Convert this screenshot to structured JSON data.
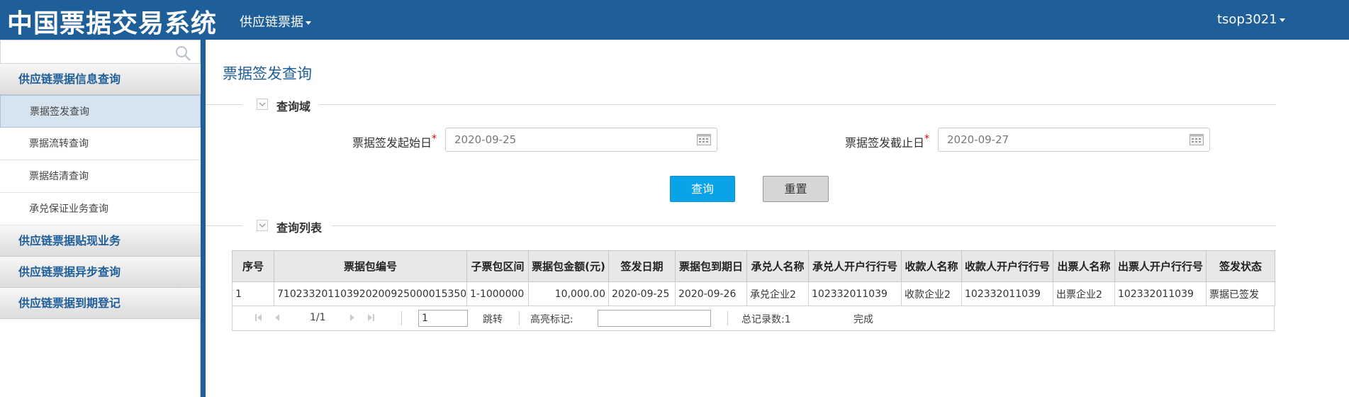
{
  "header": {
    "app_title": "中国票据交易系统",
    "nav_menu_label": "供应链票据",
    "user_label": "tsop3021"
  },
  "sidebar": {
    "search_placeholder": "",
    "groups": [
      {
        "label": "供应链票据信息查询"
      },
      {
        "label": "供应链票据贴现业务"
      },
      {
        "label": "供应链票据异步查询"
      },
      {
        "label": "供应链票据到期登记"
      }
    ],
    "items": [
      {
        "label": "票据签发查询",
        "active": true
      },
      {
        "label": "票据流转查询"
      },
      {
        "label": "票据结清查询"
      },
      {
        "label": "承兑保证业务查询"
      }
    ]
  },
  "main": {
    "page_title": "票据签发查询",
    "query_section": "查询域",
    "list_section": "查询列表",
    "start_label": "票据签发起始日",
    "end_label": "票据签发截止日",
    "required_mark": "*",
    "start_value": "2020-09-25",
    "end_value": "2020-09-27",
    "query_button": "查询",
    "reset_button": "重置"
  },
  "table": {
    "columns": [
      "序号",
      "票据包编号",
      "子票包区间",
      "票据包金额(元)",
      "签发日期",
      "票据包到期日",
      "承兑人名称",
      "承兑人开户行行号",
      "收款人名称",
      "收款人开户行行号",
      "出票人名称",
      "出票人开户行行号",
      "签发状态"
    ],
    "rows": [
      [
        "1",
        "710233201103920200925000015350",
        "1-1000000",
        "10,000.00",
        "2020-09-25",
        "2020-09-26",
        "承兑企业2",
        "102332011039",
        "收款企业2",
        "102332011039",
        "出票企业2",
        "102332011039",
        "票据已签发"
      ]
    ]
  },
  "pager": {
    "page_info": "1/1",
    "page_input": "1",
    "jump_label": "跳转",
    "highlight_label": "高亮标记:",
    "total_label": "总记录数:1",
    "status": "完成"
  },
  "colors": {
    "header_bg": "#1f5f99",
    "query_button": "#0aa3e8",
    "required": "#ee0000"
  }
}
